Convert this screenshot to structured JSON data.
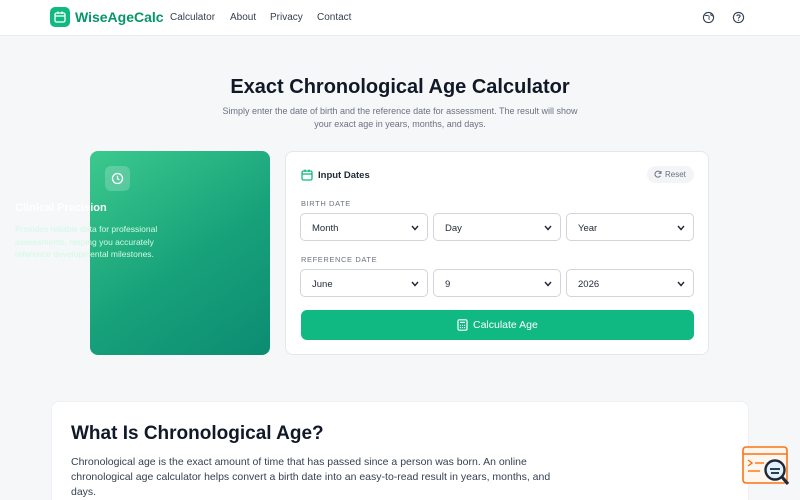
{
  "header": {
    "brand": "WiseAgeCalc",
    "nav": [
      "Calculator",
      "About",
      "Privacy",
      "Contact"
    ],
    "icons": [
      "globe-icon",
      "help-icon"
    ]
  },
  "hero": {
    "title": "Exact Chronological Age Calculator",
    "subtitle": "Simply enter the date of birth and the reference date for assessment. The result will show your exact age in years, months, and days."
  },
  "feature_card": {
    "icon": "clock-icon",
    "title": "Clinical Precision",
    "description": "Provides reliable data for professional assessments, helping you accurately reference developmental milestones."
  },
  "input_card": {
    "title": "Input Dates",
    "reset_label": "Reset",
    "birth_label": "BIRTH DATE",
    "birth": {
      "month": "Month",
      "day": "Day",
      "year": "Year"
    },
    "reference_label": "REFERENCE DATE",
    "reference": {
      "month": "June",
      "day": "9",
      "year": "2026"
    },
    "calculate_label": "Calculate Age"
  },
  "article": {
    "title": "What Is Chronological Age?",
    "body": "Chronological age is the exact amount of time that has passed since a person was born. An online chronological age calculator helps convert a birth date into an easy-to-read result in years, months, and days."
  },
  "colors": {
    "accent": "#10b981",
    "brand_text": "#059669",
    "card_gradient_start": "#3cc98d",
    "card_gradient_end": "#0c8c72"
  }
}
